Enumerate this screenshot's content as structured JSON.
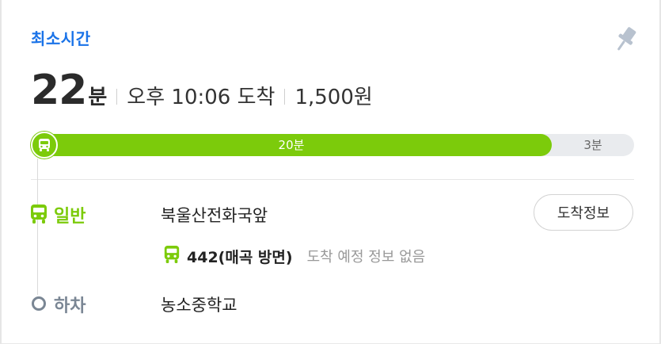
{
  "route": {
    "type_label": "최소시간",
    "duration_value": "22",
    "duration_unit": "분",
    "arrival": "오후 10:06 도착",
    "fare": "1,500원"
  },
  "progress": {
    "bus_minutes_label": "20분",
    "walk_minutes_label": "3분",
    "bus_fraction": 0.863,
    "colors": {
      "bus": "#7ccb0b",
      "rest": "#e9ebee"
    }
  },
  "steps": {
    "board": {
      "label": "일반",
      "icon": "bus-icon",
      "stop": "북울산전화국앞",
      "arrival_info_button": "도착정보",
      "bus": {
        "icon": "bus-icon",
        "name": "442(매곡 방면)",
        "status": "도착 예정 정보 없음"
      }
    },
    "alight": {
      "label": "하차",
      "stop": "농소중학교"
    }
  },
  "icons": {
    "pin": "pin-icon"
  },
  "colors": {
    "accent": "#1a73e8",
    "bus_green": "#7ccb0b",
    "alight_gray": "#7a8694"
  }
}
